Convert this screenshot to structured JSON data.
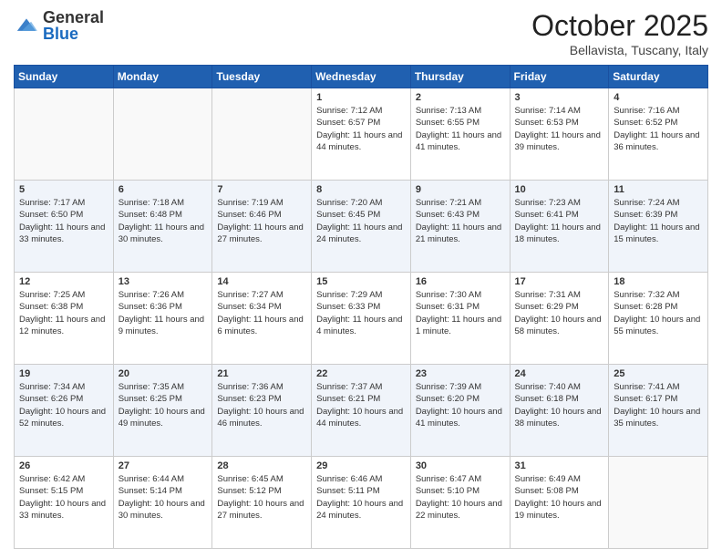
{
  "header": {
    "logo_general": "General",
    "logo_blue": "Blue",
    "month": "October 2025",
    "location": "Bellavista, Tuscany, Italy"
  },
  "weekdays": [
    "Sunday",
    "Monday",
    "Tuesday",
    "Wednesday",
    "Thursday",
    "Friday",
    "Saturday"
  ],
  "weeks": [
    [
      {
        "day": "",
        "info": ""
      },
      {
        "day": "",
        "info": ""
      },
      {
        "day": "",
        "info": ""
      },
      {
        "day": "1",
        "info": "Sunrise: 7:12 AM\nSunset: 6:57 PM\nDaylight: 11 hours and 44 minutes."
      },
      {
        "day": "2",
        "info": "Sunrise: 7:13 AM\nSunset: 6:55 PM\nDaylight: 11 hours and 41 minutes."
      },
      {
        "day": "3",
        "info": "Sunrise: 7:14 AM\nSunset: 6:53 PM\nDaylight: 11 hours and 39 minutes."
      },
      {
        "day": "4",
        "info": "Sunrise: 7:16 AM\nSunset: 6:52 PM\nDaylight: 11 hours and 36 minutes."
      }
    ],
    [
      {
        "day": "5",
        "info": "Sunrise: 7:17 AM\nSunset: 6:50 PM\nDaylight: 11 hours and 33 minutes."
      },
      {
        "day": "6",
        "info": "Sunrise: 7:18 AM\nSunset: 6:48 PM\nDaylight: 11 hours and 30 minutes."
      },
      {
        "day": "7",
        "info": "Sunrise: 7:19 AM\nSunset: 6:46 PM\nDaylight: 11 hours and 27 minutes."
      },
      {
        "day": "8",
        "info": "Sunrise: 7:20 AM\nSunset: 6:45 PM\nDaylight: 11 hours and 24 minutes."
      },
      {
        "day": "9",
        "info": "Sunrise: 7:21 AM\nSunset: 6:43 PM\nDaylight: 11 hours and 21 minutes."
      },
      {
        "day": "10",
        "info": "Sunrise: 7:23 AM\nSunset: 6:41 PM\nDaylight: 11 hours and 18 minutes."
      },
      {
        "day": "11",
        "info": "Sunrise: 7:24 AM\nSunset: 6:39 PM\nDaylight: 11 hours and 15 minutes."
      }
    ],
    [
      {
        "day": "12",
        "info": "Sunrise: 7:25 AM\nSunset: 6:38 PM\nDaylight: 11 hours and 12 minutes."
      },
      {
        "day": "13",
        "info": "Sunrise: 7:26 AM\nSunset: 6:36 PM\nDaylight: 11 hours and 9 minutes."
      },
      {
        "day": "14",
        "info": "Sunrise: 7:27 AM\nSunset: 6:34 PM\nDaylight: 11 hours and 6 minutes."
      },
      {
        "day": "15",
        "info": "Sunrise: 7:29 AM\nSunset: 6:33 PM\nDaylight: 11 hours and 4 minutes."
      },
      {
        "day": "16",
        "info": "Sunrise: 7:30 AM\nSunset: 6:31 PM\nDaylight: 11 hours and 1 minute."
      },
      {
        "day": "17",
        "info": "Sunrise: 7:31 AM\nSunset: 6:29 PM\nDaylight: 10 hours and 58 minutes."
      },
      {
        "day": "18",
        "info": "Sunrise: 7:32 AM\nSunset: 6:28 PM\nDaylight: 10 hours and 55 minutes."
      }
    ],
    [
      {
        "day": "19",
        "info": "Sunrise: 7:34 AM\nSunset: 6:26 PM\nDaylight: 10 hours and 52 minutes."
      },
      {
        "day": "20",
        "info": "Sunrise: 7:35 AM\nSunset: 6:25 PM\nDaylight: 10 hours and 49 minutes."
      },
      {
        "day": "21",
        "info": "Sunrise: 7:36 AM\nSunset: 6:23 PM\nDaylight: 10 hours and 46 minutes."
      },
      {
        "day": "22",
        "info": "Sunrise: 7:37 AM\nSunset: 6:21 PM\nDaylight: 10 hours and 44 minutes."
      },
      {
        "day": "23",
        "info": "Sunrise: 7:39 AM\nSunset: 6:20 PM\nDaylight: 10 hours and 41 minutes."
      },
      {
        "day": "24",
        "info": "Sunrise: 7:40 AM\nSunset: 6:18 PM\nDaylight: 10 hours and 38 minutes."
      },
      {
        "day": "25",
        "info": "Sunrise: 7:41 AM\nSunset: 6:17 PM\nDaylight: 10 hours and 35 minutes."
      }
    ],
    [
      {
        "day": "26",
        "info": "Sunrise: 6:42 AM\nSunset: 5:15 PM\nDaylight: 10 hours and 33 minutes."
      },
      {
        "day": "27",
        "info": "Sunrise: 6:44 AM\nSunset: 5:14 PM\nDaylight: 10 hours and 30 minutes."
      },
      {
        "day": "28",
        "info": "Sunrise: 6:45 AM\nSunset: 5:12 PM\nDaylight: 10 hours and 27 minutes."
      },
      {
        "day": "29",
        "info": "Sunrise: 6:46 AM\nSunset: 5:11 PM\nDaylight: 10 hours and 24 minutes."
      },
      {
        "day": "30",
        "info": "Sunrise: 6:47 AM\nSunset: 5:10 PM\nDaylight: 10 hours and 22 minutes."
      },
      {
        "day": "31",
        "info": "Sunrise: 6:49 AM\nSunset: 5:08 PM\nDaylight: 10 hours and 19 minutes."
      },
      {
        "day": "",
        "info": ""
      }
    ]
  ]
}
